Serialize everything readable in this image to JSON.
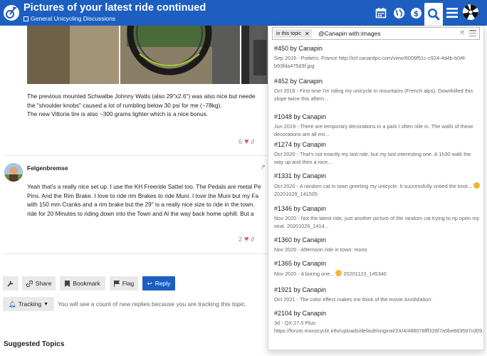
{
  "header": {
    "title": "Pictures of your latest ride continued",
    "category": "General Unicycling Discussions",
    "icons": [
      "unicycle-logo",
      "calendar-icon",
      "globe-icon",
      "dollar-globe-icon",
      "search-icon",
      "hamburger-menu-icon",
      "user-avatar"
    ]
  },
  "post1": {
    "lines": [
      "The previous mounted Schwalbe Johnny Watts (also 29\"x2.6\") was also nice but neede",
      "the \"shoulder knobs\" caused a lot of rumbling below 30 psi for me (~78kg).",
      "The new Vittoria tire is also ~300 grams lighter which is a nice bonus."
    ],
    "likes": "6"
  },
  "post2": {
    "author": "Felgenbremse",
    "lines": [
      "Yeah that's a really nice set up. I use the KH Freeride Sattel too. The Pedals are metal Pe",
      "Pins. And the Rim Brake. I love to ride rim Brakes to ride Muni. I love the Muni but my Fa",
      "with 150 mm Cranks and a rim brake but the 29\" is a really nice size to ride in the town.",
      "ride for 20 Minutes to riding down into the Town and Al the way back home uphill. But a"
    ],
    "likes": "2"
  },
  "footer": {
    "share": "Share",
    "bookmark": "Bookmark",
    "flag": "Flag",
    "reply": "Reply",
    "tracking": "Tracking",
    "tracking_note": "You will see a count of new replies because you are tracking this topic.",
    "suggested": "Suggested Topics"
  },
  "search": {
    "context": "in this topic",
    "query": "@Canapin with:images",
    "results": [
      {
        "title": "#450 by Canapin",
        "blurb": "Sep 2016 - Poitiers, France http://tof.canardpc.com/view/6009f51c-c924-4d4b-b04f-b93fda475d3f.jpg"
      },
      {
        "title": "#452 by Canapin",
        "blurb": "Oct 2016 - First time I'm riding my unicycle in mountains (French alps). Downhilled this slope twice this aftern..."
      },
      {
        "title": "#1048 by Canapin",
        "blurb": "Jun 2019 - There are temporary decorations in a park I often ride in. The walls of these decorations are all mir..."
      },
      {
        "title": "#1274 by Canapin",
        "blurb": "Oct 2020 - That's not exactly my last ride, but my last interesting one. A 1h30 walk the way up and then a nice..."
      },
      {
        "title": "#1331 by Canapin",
        "blurb": "Oct 2020 - A random cat in town greeting my unicycle. It successfully untied the knot...",
        "emoji": "cat-emoji",
        "tail": "20201029_141505"
      },
      {
        "title": "#1346 by Canapin",
        "blurb": "Nov 2020 - Not the latest ride, just another picture of the random cat trying to rip open my seat. 20201029_1414..."
      },
      {
        "title": "#1360 by Canapin",
        "blurb": "Nov 2020 - Afternoon ride in town: mono"
      },
      {
        "title": "#1365 by Canapin",
        "blurb": "Nov 2020 - A boring one...",
        "emoji": "grin-emoji",
        "tail": "20201123_145340"
      },
      {
        "title": "#1921 by Canapin",
        "blurb": "Oct 2021 - The color effect makes me think of the movie Annihilation:"
      },
      {
        "title": "#2104 by Canapin",
        "blurb": "3d - QX 27.5 Plus: https://forum.monocycle.info/uploads/default/original/2X/4/488078fff326f7a5be883597cd09..."
      }
    ]
  }
}
